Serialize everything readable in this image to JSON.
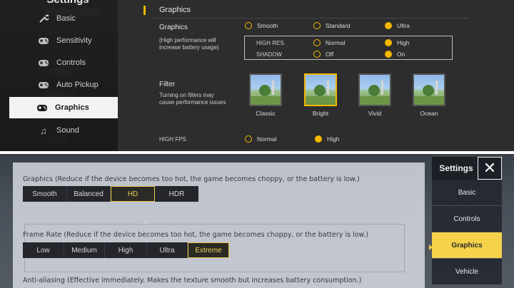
{
  "top": {
    "sidebar": {
      "title": "Settings",
      "items": [
        {
          "label": "Basic",
          "icon": "wrench-icon"
        },
        {
          "label": "Sensitivity",
          "icon": "gamepad-icon"
        },
        {
          "label": "Controls",
          "icon": "gamepad-icon"
        },
        {
          "label": "Auto Pickup",
          "icon": "gamepad-icon"
        },
        {
          "label": "Graphics",
          "icon": "gamepad-icon"
        },
        {
          "label": "Sound",
          "icon": "music-icon"
        }
      ]
    },
    "section_title": "Graphics",
    "graphics": {
      "label": "Graphics",
      "note": "(High performance will increase battery usage)",
      "options": [
        "Smooth",
        "Standard",
        "Ultra"
      ],
      "selected": "Ultra"
    },
    "high_res": {
      "label": "HIGH RES.",
      "options": [
        "Normal",
        "High"
      ],
      "selected": "High"
    },
    "shadow": {
      "label": "SHADOW",
      "options": [
        "Off",
        "On"
      ],
      "selected": "On"
    },
    "filter": {
      "label": "Filter",
      "note": "Turning on filters may cause performance issues",
      "options": [
        "Classic",
        "Bright",
        "Vivid",
        "Ocean"
      ],
      "selected": "Bright"
    },
    "high_fps": {
      "label": "HIGH FPS",
      "options": [
        "Normal",
        "High"
      ],
      "selected": "High"
    },
    "accent": "#f5b800"
  },
  "bottom": {
    "graphics_heading": "Graphics (Reduce if the device becomes too hot, the game becomes choppy, or the battery is low.)",
    "graphics_options": [
      "Smooth",
      "Balanced",
      "HD",
      "HDR"
    ],
    "graphics_selected": "HD",
    "frame_heading": "Frame Rate (Reduce if the device becomes too hot, the game becomes choppy, or the battery is low.)",
    "frame_options": [
      "Low",
      "Medium",
      "High",
      "Ultra",
      "Extreme"
    ],
    "frame_selected": "Extreme",
    "aa_heading": "Anti-aliasing (Effective immediately. Makes the texture smooth but increases battery consumption.)",
    "settings_title": "Settings",
    "close_icon": "close-icon",
    "menu": [
      "Basic",
      "Controls",
      "Graphics",
      "Vehicle"
    ],
    "menu_selected": "Graphics",
    "accent": "#f6d24a"
  }
}
